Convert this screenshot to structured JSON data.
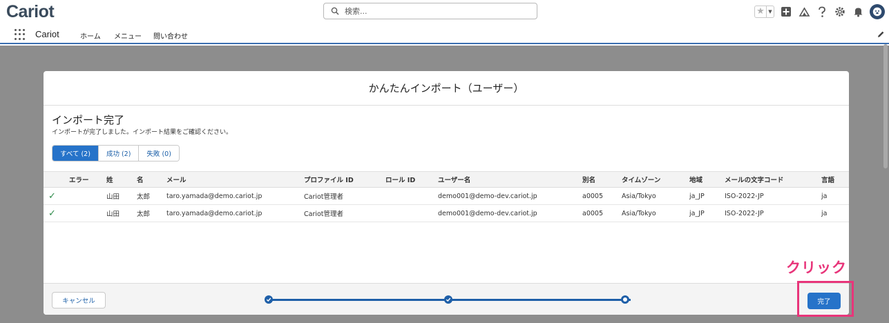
{
  "header": {
    "logo": "Cariot",
    "search_placeholder": "検索..."
  },
  "nav": {
    "app_name": "Cariot",
    "items": [
      "ホーム",
      "メニュー",
      "問い合わせ"
    ]
  },
  "modal": {
    "title": "かんたんインポート（ユーザー）",
    "section_title": "インポート完了",
    "section_subtitle": "インポートが完了しました。インポート結果をご確認ください。",
    "tabs": [
      {
        "label": "すべて (2)",
        "active": true
      },
      {
        "label": "成功 (2)",
        "active": false
      },
      {
        "label": "失敗 (0)",
        "active": false
      }
    ],
    "table": {
      "columns": [
        "エラー",
        "姓",
        "名",
        "メール",
        "プロファイル ID",
        "ロール ID",
        "ユーザー名",
        "別名",
        "タイムゾーン",
        "地域",
        "メールの文字コード",
        "言語"
      ],
      "rows": [
        {
          "status": "success",
          "cells": [
            "",
            "山田",
            "太郎",
            "taro.yamada@demo.cariot.jp",
            "Cariot管理者",
            "",
            "demo001@demo-dev.cariot.jp",
            "a0005",
            "Asia/Tokyo",
            "ja_JP",
            "ISO-2022-JP",
            "ja"
          ]
        },
        {
          "status": "success",
          "cells": [
            "",
            "山田",
            "太郎",
            "taro.yamada@demo.cariot.jp",
            "Cariot管理者",
            "",
            "demo001@demo-dev.cariot.jp",
            "a0005",
            "Asia/Tokyo",
            "ja_JP",
            "ISO-2022-JP",
            "ja"
          ]
        }
      ]
    },
    "footer": {
      "cancel_label": "キャンセル",
      "done_label": "完了",
      "progress_steps": 3,
      "current_step": 3
    }
  },
  "annotation": {
    "text": "クリック",
    "color": "#e8357a"
  },
  "colors": {
    "accent": "#2673c9",
    "success": "#2e8b4a",
    "overlay": "#8d8d8d"
  }
}
